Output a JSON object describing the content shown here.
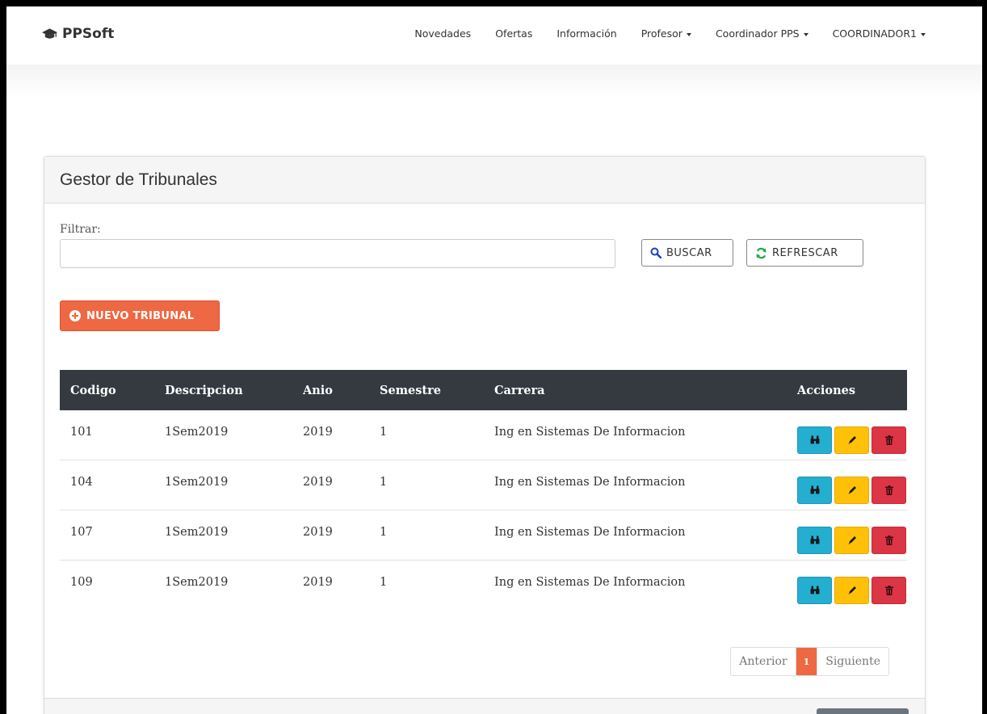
{
  "navbar": {
    "brand": "PPSoft",
    "items": [
      {
        "label": "Novedades",
        "dropdown": false
      },
      {
        "label": "Ofertas",
        "dropdown": false
      },
      {
        "label": "Información",
        "dropdown": false
      },
      {
        "label": "Profesor",
        "dropdown": true
      },
      {
        "label": "Coordinador PPS",
        "dropdown": true
      },
      {
        "label": "COORDINADOR1",
        "dropdown": true
      }
    ]
  },
  "panel": {
    "title": "Gestor de Tribunales",
    "filter_label": "Filtrar:",
    "filter_value": "",
    "search_button": "BUSCAR",
    "refresh_button": "REFRESCAR",
    "new_button": "NUEVO TRIBUNAL"
  },
  "table": {
    "headers": [
      "Codigo",
      "Descripcion",
      "Anio",
      "Semestre",
      "Carrera",
      "Acciones"
    ],
    "rows": [
      [
        "101",
        "1Sem2019",
        "2019",
        "1",
        "Ing en Sistemas De Informacion"
      ],
      [
        "104",
        "1Sem2019",
        "2019",
        "1",
        "Ing en Sistemas De Informacion"
      ],
      [
        "107",
        "1Sem2019",
        "2019",
        "1",
        "Ing en Sistemas De Informacion"
      ],
      [
        "109",
        "1Sem2019",
        "2019",
        "1",
        "Ing en Sistemas De Informacion"
      ]
    ],
    "action_icons": [
      "binoculars-icon",
      "pencil-icon",
      "trash-icon"
    ]
  },
  "pagination": {
    "prev": "Anterior",
    "current": "1",
    "next": "Siguiente"
  },
  "colors": {
    "accent": "#ee6843",
    "table_header": "#343a40",
    "view": "#24aed0",
    "edit": "#ffc107",
    "delete": "#dc3545"
  }
}
